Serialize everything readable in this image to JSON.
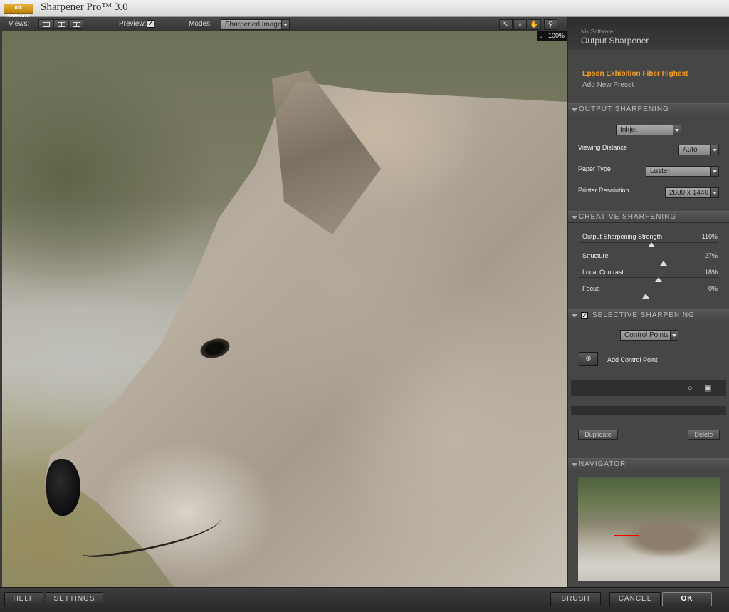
{
  "window": {
    "logo_text": "nik Software",
    "title": "Sharpener Pro™ 3.0"
  },
  "toolbar": {
    "views_label": "Views:",
    "preview_label": "Preview:",
    "preview_checked": "✓",
    "modes_label": "Modes:",
    "modes_value": "Sharpened Image",
    "zoom_level": "100%"
  },
  "panel": {
    "vendor": "Nik Software",
    "title": "Output Sharpener",
    "presets": {
      "active": "Epson Exhibition Fiber Highest",
      "add": "Add New Preset"
    },
    "output_sharpening": {
      "header": "OUTPUT SHARPENING",
      "printer_type": "Inkjet",
      "viewing_distance_label": "Viewing Distance",
      "viewing_distance_value": "Auto",
      "paper_type_label": "Paper Type",
      "paper_type_value": "Luster",
      "printer_resolution_label": "Printer Resolution",
      "printer_resolution_value": "2880 x 1440"
    },
    "creative_sharpening": {
      "header": "CREATIVE SHARPENING",
      "sliders": [
        {
          "label": "Output Sharpening Strength",
          "value": "110%",
          "fraction": 0.52
        },
        {
          "label": "Structure",
          "value": "27%",
          "fraction": 0.61
        },
        {
          "label": "Local Contrast",
          "value": "18%",
          "fraction": 0.57
        },
        {
          "label": "Focus",
          "value": "0%",
          "fraction": 0.48
        }
      ]
    },
    "selective_sharpening": {
      "header": "SELECTIVE SHARPENING",
      "enabled": "✓",
      "mode": "Control Points",
      "add_label": "Add Control Point",
      "duplicate": "Duplicate",
      "delete": "Delete"
    },
    "navigator": {
      "header": "NAVIGATOR"
    }
  },
  "bottom": {
    "help": "HELP",
    "settings": "SETTINGS",
    "brush": "BRUSH",
    "cancel": "CANCEL",
    "ok": "OK"
  }
}
